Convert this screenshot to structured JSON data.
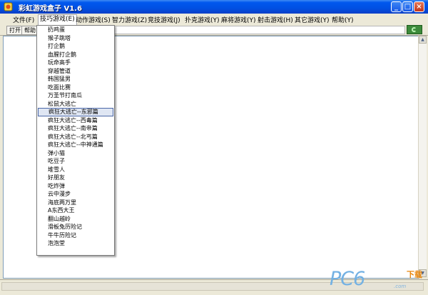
{
  "window": {
    "title": "彩虹游戏盒子 V1.6"
  },
  "menubar": {
    "items": [
      {
        "label": "文件(F)"
      },
      {
        "label": "技巧游戏(E)"
      },
      {
        "label": "动作游戏(S)"
      },
      {
        "label": "智力游戏(Z)"
      },
      {
        "label": "竞技游戏(J)"
      },
      {
        "label": "扑克游戏(Y)"
      },
      {
        "label": "麻将游戏(Y)"
      },
      {
        "label": "射击游戏(H)"
      },
      {
        "label": "其它游戏(Y)"
      },
      {
        "label": "帮助(Y)"
      }
    ]
  },
  "toolbar": {
    "open_label": "打开",
    "help_label": "帮助"
  },
  "dropdown": {
    "items": [
      "扔鸡蛋",
      "猴子跳塔",
      "打企鹅",
      "血腥打企鹅",
      "玩命高手",
      "穿越管道",
      "韩国猛男",
      "吃面比赛",
      "万圣节打南瓜",
      "松鼠大逃亡",
      "疯狂大逃亡--东邪篇",
      "疯狂大逃亡--西毒篇",
      "疯狂大逃亡--南帝篇",
      "疯狂大逃亡--北丐篇",
      "疯狂大逃亡--中神通篇",
      "弹小猫",
      "吃豆子",
      "堆雪人",
      "好朋友",
      "吃炸弹",
      "云中漫步",
      "海底两万里",
      "A东西大王",
      "翻山越岭",
      "滑板兔历险记",
      "牛牛历险记",
      "泡泡堂"
    ],
    "highlighted_index": 10
  },
  "watermark": {
    "brand": "PC6",
    "xiazai": "下载",
    "url": ".com"
  },
  "colors": {
    "title_blue": "#0050e3",
    "highlight": "#dfe6f3"
  }
}
